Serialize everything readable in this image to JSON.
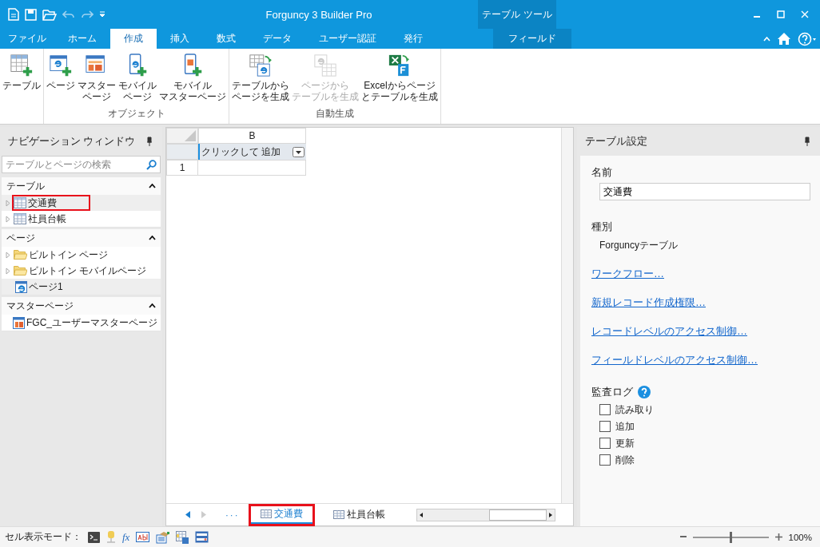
{
  "title_bar": {
    "title": "Forguncy 3 Builder Pro",
    "context_title": "テーブル ツール"
  },
  "ribbon_tabs": [
    {
      "label": "ファイル",
      "selected": false,
      "contextual": false
    },
    {
      "label": "ホーム",
      "selected": false,
      "contextual": false
    },
    {
      "label": "作成",
      "selected": true,
      "contextual": false
    },
    {
      "label": "挿入",
      "selected": false,
      "contextual": false
    },
    {
      "label": "数式",
      "selected": false,
      "contextual": false
    },
    {
      "label": "データ",
      "selected": false,
      "contextual": false
    },
    {
      "label": "ユーザー認証",
      "selected": false,
      "contextual": false
    },
    {
      "label": "発行",
      "selected": false,
      "contextual": false
    },
    {
      "label": "フィールド",
      "selected": false,
      "contextual": true
    }
  ],
  "ribbon_groups": [
    {
      "buttons": [
        {
          "kind": "table",
          "lines": [
            "テーブル"
          ],
          "disabled": false
        }
      ]
    },
    {
      "label": "オブジェクト",
      "buttons": [
        {
          "kind": "page",
          "lines": [
            "ページ"
          ],
          "disabled": false
        },
        {
          "kind": "master",
          "lines": [
            "マスター",
            "ページ"
          ],
          "disabled": false
        },
        {
          "kind": "mobile",
          "lines": [
            "モバイル",
            "ページ"
          ],
          "disabled": false
        },
        {
          "kind": "mobile-master",
          "lines": [
            "モバイル",
            "マスターページ"
          ],
          "disabled": false
        }
      ]
    },
    {
      "label": "自動生成",
      "buttons": [
        {
          "kind": "gen-page",
          "lines": [
            "テーブルから",
            "ページを生成"
          ],
          "disabled": false
        },
        {
          "kind": "gen-table",
          "lines": [
            "ページから",
            "テーブルを生成"
          ],
          "disabled": true
        },
        {
          "kind": "excel",
          "lines": [
            "Excelからページ",
            "とテーブルを生成"
          ],
          "disabled": false
        }
      ]
    }
  ],
  "navigation": {
    "title": "ナビゲーション ウィンドウ",
    "search": {
      "placeholder": "テーブルとページの検索"
    },
    "sections": [
      {
        "title": "テーブル",
        "expanded": true,
        "items": [
          {
            "kind": "table",
            "label": "交通費",
            "expanded": false,
            "selected": true,
            "highlighted": true
          },
          {
            "kind": "table",
            "label": "社員台帳",
            "expanded": false,
            "selected": false,
            "highlighted": false
          }
        ]
      },
      {
        "title": "ページ",
        "expanded": true,
        "items": [
          {
            "kind": "folder",
            "label": "ビルトイン ページ",
            "expanded": false,
            "selected": false,
            "highlighted": false
          },
          {
            "kind": "folder",
            "label": "ビルトイン モバイルページ",
            "expanded": false,
            "selected": false,
            "highlighted": false
          },
          {
            "kind": "page",
            "label": "ページ1",
            "selected": true,
            "highlighted": false
          }
        ]
      },
      {
        "title": "マスターページ",
        "expanded": true,
        "items": [
          {
            "kind": "master",
            "label": "FGC_ユーザーマスターページ",
            "selected": false,
            "highlighted": false
          }
        ]
      }
    ]
  },
  "grid": {
    "column": "B",
    "add_field": "クリックして 追加",
    "row_number": "1"
  },
  "sheet_tabs": {
    "more": "···",
    "tabs": [
      {
        "label": "交通費",
        "selected": true,
        "highlighted": true
      },
      {
        "label": "社員台帳",
        "selected": false,
        "highlighted": false
      }
    ]
  },
  "properties": {
    "title": "テーブル設定",
    "name_label": "名前",
    "name_value": "交通費",
    "type_label": "種別",
    "type_value": "Forguncyテーブル",
    "links": [
      "ワークフロー…",
      "新規レコード作成権限…",
      "レコードレベルのアクセス制御…",
      "フィールドレベルのアクセス制御…"
    ],
    "audit_label": "監査ログ",
    "audit_options": [
      {
        "label": "読み取り",
        "checked": false
      },
      {
        "label": "追加",
        "checked": false
      },
      {
        "label": "更新",
        "checked": false
      },
      {
        "label": "削除",
        "checked": false
      }
    ]
  },
  "status_bar": {
    "mode_label": "セル表示モード：",
    "formula_symbol": "fx",
    "zoom": {
      "level": 0.5,
      "reading": "100%"
    }
  }
}
